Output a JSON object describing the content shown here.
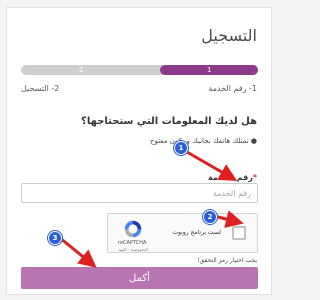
{
  "page": {
    "title": "التسجيل"
  },
  "steps": [
    {
      "number": "1",
      "label": "1- رقم الخدمة",
      "active": true
    },
    {
      "number": "2",
      "label": "2- التسجيل",
      "active": false
    }
  ],
  "form": {
    "question": "هل لديك المعلومات التي ستحتاجها؟",
    "bullet": "تمتلك هاتفك بجانبك و يكون مفتوح",
    "service_label": "رقم الخدمة",
    "required_mark": "*",
    "service_placeholder": "رقم الخدمة",
    "service_value": "",
    "captcha": {
      "checkbox_label": "لست برنامج روبوت",
      "brand": "reCAPTCHA",
      "terms": "الخصوصية - البنود",
      "checked": false
    },
    "captcha_warning": "يجب اختيار رمز التحقق!",
    "submit_label": "أكمل"
  },
  "annotations": {
    "badges": [
      "1",
      "2",
      "3"
    ],
    "arrow_color": "#e02020",
    "badge_color": "#2b5fd9"
  },
  "colors": {
    "accent": "#8a3b8c",
    "button": "#b776b1"
  }
}
